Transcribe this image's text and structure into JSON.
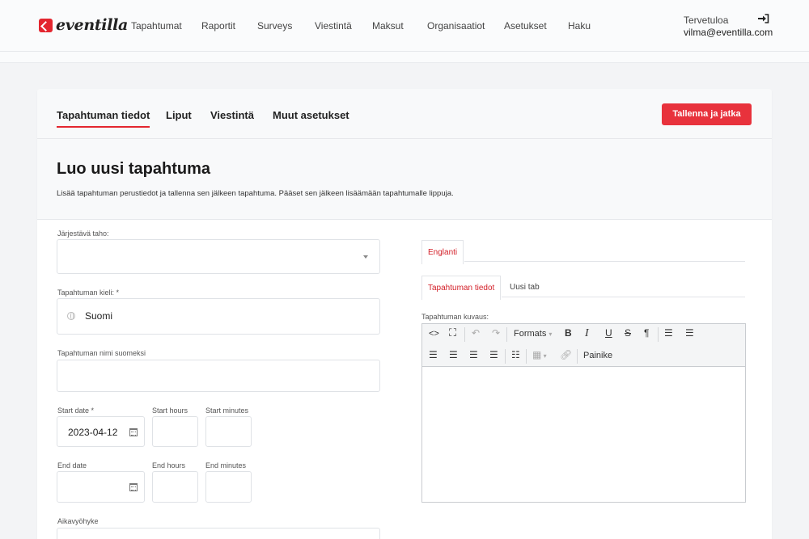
{
  "brand": {
    "name": "eventilla",
    "accent": "#e3262f"
  },
  "nav": {
    "items": [
      "Tapahtumat",
      "Raportit",
      "Surveys",
      "Viestintä",
      "Maksut",
      "Organisaatiot",
      "Asetukset",
      "Haku"
    ]
  },
  "user": {
    "greeting": "Tervetuloa",
    "email": "vilma@eventilla.com",
    "logout_icon": "sign-out-icon"
  },
  "tabs": [
    "Tapahtuman tiedot",
    "Liput",
    "Viestintä",
    "Muut asetukset"
  ],
  "save_button": "Tallenna ja jatka",
  "page": {
    "title": "Luo uusi tapahtuma",
    "description": "Lisää tapahtuman perustiedot ja tallenna sen jälkeen tapahtuma. Pääset sen jälkeen lisäämään tapahtumalle lippuja."
  },
  "form": {
    "organizer_label": "Järjestävä taho:",
    "organizer_value": "",
    "language_label": "Tapahtuman kieli: *",
    "language_value": "Suomi",
    "name_label": "Tapahtuman nimi suomeksi",
    "name_value": "",
    "start_date_label": "Start date *",
    "start_date_value": "2023-04-12",
    "start_hours_label": "Start hours",
    "start_minutes_label": "Start minutes",
    "end_date_label": "End date",
    "end_date_value": "",
    "end_hours_label": "End hours",
    "end_minutes_label": "End minutes",
    "timezone_label": "Aikavyöhyke"
  },
  "editor": {
    "lang_tab": "Englanti",
    "sub_tabs": [
      "Tapahtuman tiedot",
      "Uusi tab"
    ],
    "description_label": "Tapahtuman kuvaus:",
    "formats_label": "Formats",
    "button_label": "Painike",
    "content": ""
  }
}
